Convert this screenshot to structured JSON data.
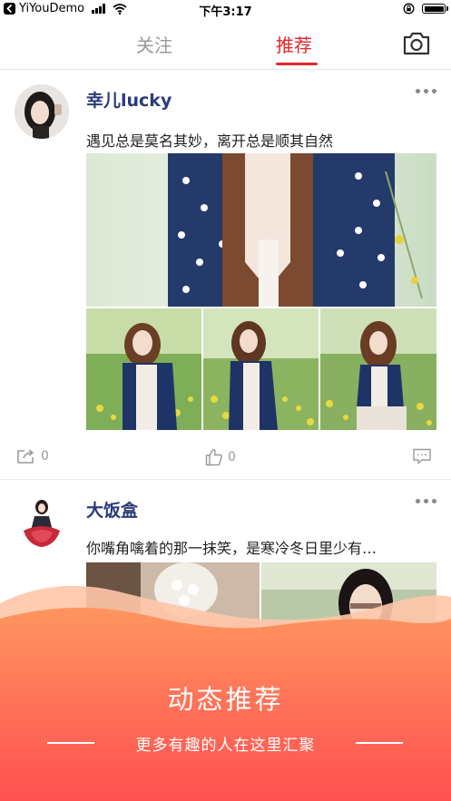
{
  "status_bar": {
    "carrier": "YiYouDemo",
    "time": "下午3:17"
  },
  "nav": {
    "tabs": [
      {
        "label": "关注",
        "active": false
      },
      {
        "label": "推荐",
        "active": true
      }
    ],
    "accent_color": "#e5262b",
    "camera_icon": "camera-icon"
  },
  "posts": [
    {
      "username": "幸儿lucky",
      "text": "遇见总是莫名其妙，离开总是顺其自然",
      "shares": "0",
      "likes": "0"
    },
    {
      "username": "大饭盒",
      "text": "你嘴角噙着的那一抹笑，是寒冷冬日里少有…"
    }
  ],
  "banner": {
    "title": "动态推荐",
    "subtitle": "更多有趣的人在这里汇聚",
    "gradient": [
      "#ff9560",
      "#ff5050"
    ]
  }
}
